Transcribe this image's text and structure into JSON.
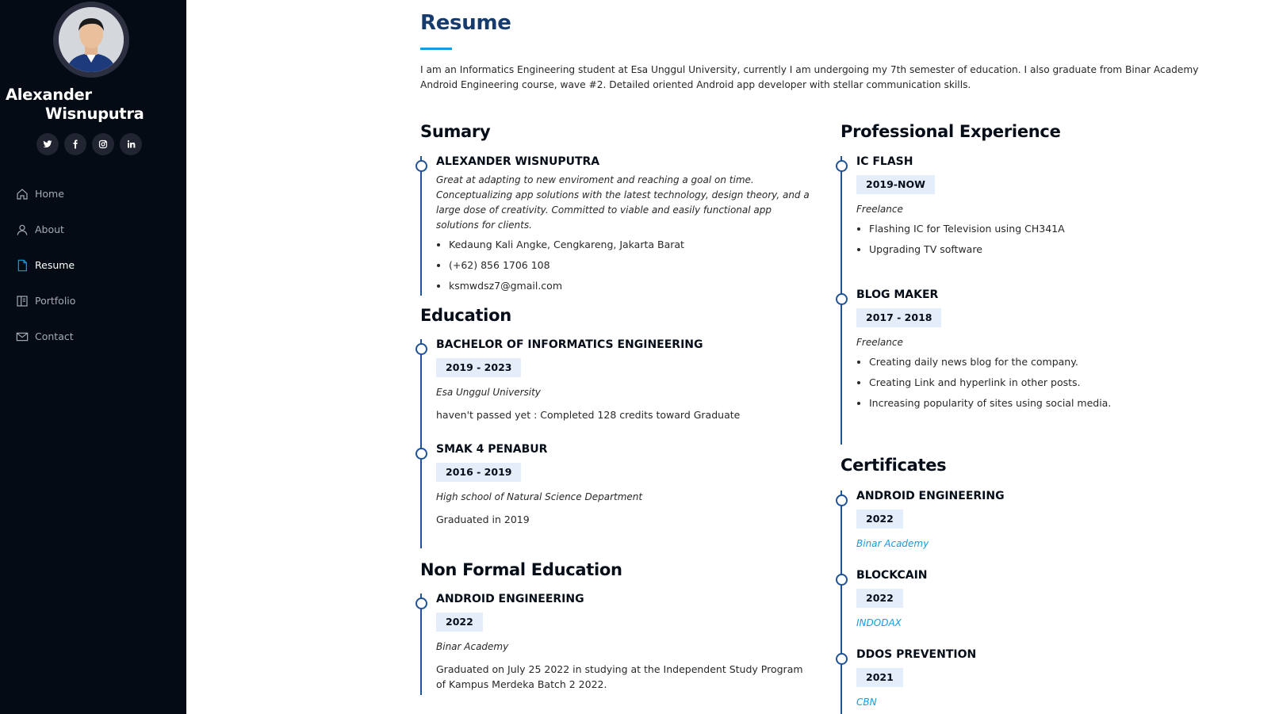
{
  "sidebar": {
    "name_first": "Alexander",
    "name_last": "Wisnuputra",
    "social": [
      {
        "icon": "twitter-icon",
        "glyph": "🐦"
      },
      {
        "icon": "facebook-icon",
        "glyph": "f"
      },
      {
        "icon": "instagram-icon",
        "glyph": "◎"
      },
      {
        "icon": "linkedin-icon",
        "glyph": "in"
      }
    ],
    "nav": [
      {
        "label": "Home",
        "icon": "home-icon"
      },
      {
        "label": "About",
        "icon": "person-icon"
      },
      {
        "label": "Resume",
        "icon": "file-icon",
        "active": true
      },
      {
        "label": "Portfolio",
        "icon": "book-icon"
      },
      {
        "label": "Contact",
        "icon": "envelope-icon"
      }
    ]
  },
  "main": {
    "title": "Resume",
    "intro": "I am an Informatics Engineering student at Esa Unggul University, currently I am undergoing my 7th semester of education. I also graduate from Binar Academy Android Engineering course, wave #2. Detailed oriented Android app developer with stellar communication skills.",
    "summary": {
      "title": "Sumary",
      "name": "ALEXANDER WISNUPUTRA",
      "description": "Great at adapting to new enviroment and reaching a goal on time. Conceptualizing app solutions with the latest technology, design theory, and a large dose of creativity. Committed to viable and easily functional app solutions for clients.",
      "contacts": [
        "Kedaung Kali Angke, Cengkareng, Jakarta Barat",
        "(+62) 856 1706 108",
        "ksmwdsz7@gmail.com"
      ]
    },
    "education": {
      "title": "Education",
      "items": [
        {
          "title": "BACHELOR OF INFORMATICS ENGINEERING",
          "date": "2019 - 2023",
          "place": "Esa Unggul University",
          "note": "haven't passed yet : Completed 128 credits toward Graduate"
        },
        {
          "title": "SMAK 4 PENABUR",
          "date": "2016 - 2019",
          "place": "High school of Natural Science Department",
          "note": "Graduated in 2019"
        }
      ]
    },
    "nonformal": {
      "title": "Non Formal Education",
      "items": [
        {
          "title": "ANDROID ENGINEERING",
          "date": "2022",
          "place": "Binar Academy",
          "note": "Graduated on July 25 2022 in studying at the Independent Study Program of Kampus Merdeka Batch 2 2022."
        }
      ]
    },
    "experience": {
      "title": "Professional Experience",
      "items": [
        {
          "title": "IC FLASH",
          "date": "2019-NOW",
          "type": "Freelance",
          "points": [
            "Flashing IC for Television using CH341A",
            "Upgrading TV software"
          ]
        },
        {
          "title": "BLOG MAKER",
          "date": "2017 - 2018",
          "type": "Freelance",
          "points": [
            "Creating daily news blog for the company.",
            "Creating Link and hyperlink in other posts.",
            "Increasing popularity of sites using social media."
          ]
        }
      ]
    },
    "certificates": {
      "title": "Certificates",
      "items": [
        {
          "title": "ANDROID ENGINEERING",
          "date": "2022",
          "issuer": "Binar Academy"
        },
        {
          "title": "BLOCKCAIN",
          "date": "2022",
          "issuer": "INDODAX"
        },
        {
          "title": "DDOS PREVENTION",
          "date": "2021",
          "issuer": "CBN"
        }
      ]
    }
  },
  "colors": {
    "sidebar_bg": "#040b14",
    "accent": "#149ddd",
    "title": "#173b6c",
    "timeline": "#1f5297",
    "date_bg": "#e4edf9"
  }
}
